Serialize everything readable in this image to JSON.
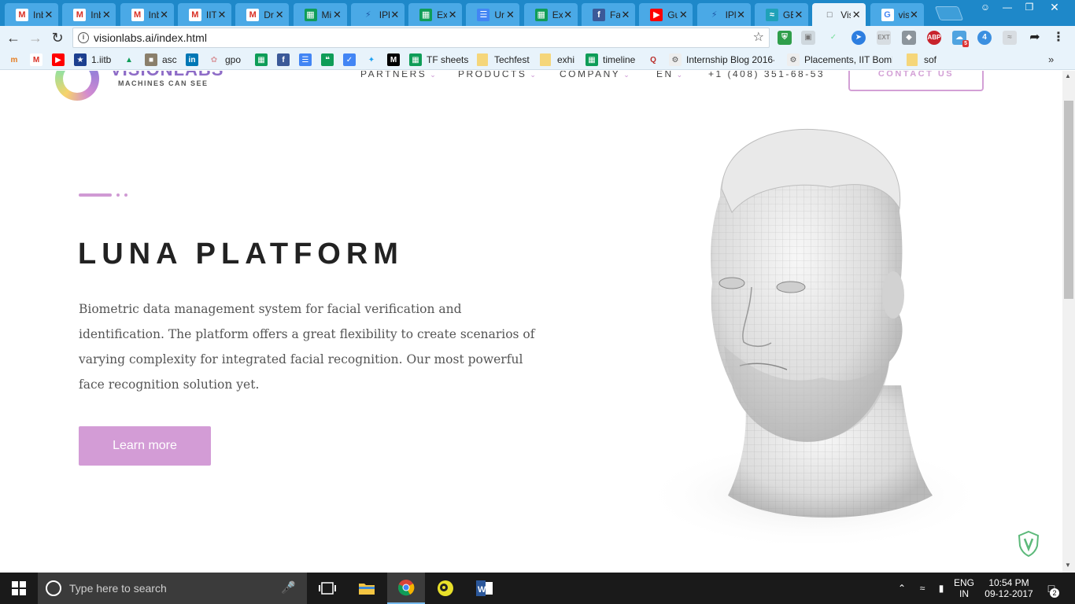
{
  "tabs": [
    {
      "icon": "gmail-icon",
      "title": "Inb"
    },
    {
      "icon": "gmail-icon",
      "title": "Inb"
    },
    {
      "icon": "gmail-icon",
      "title": "Inb"
    },
    {
      "icon": "gmail-icon",
      "title": "IIT"
    },
    {
      "icon": "gmail-icon",
      "title": "Dr"
    },
    {
      "icon": "sheets-icon",
      "title": "Mi"
    },
    {
      "icon": "ipl-icon",
      "title": "IPl"
    },
    {
      "icon": "sheets-icon",
      "title": "Ex"
    },
    {
      "icon": "docs-icon",
      "title": "Ur"
    },
    {
      "icon": "sheets-icon",
      "title": "Ex"
    },
    {
      "icon": "facebook-icon",
      "title": "Fa"
    },
    {
      "icon": "youtube-icon",
      "title": "Gu"
    },
    {
      "icon": "ipl-icon",
      "title": "IPl"
    },
    {
      "icon": "ge-icon",
      "title": "GE"
    },
    {
      "icon": "page-icon",
      "title": "Vis",
      "active": true
    },
    {
      "icon": "google-icon",
      "title": "vis"
    }
  ],
  "address_bar": {
    "url": "visionlabs.ai/index.html"
  },
  "bookmarks": [
    {
      "icon": "mail-m-icon",
      "label": ""
    },
    {
      "icon": "gmail-icon",
      "label": ""
    },
    {
      "icon": "youtube-icon",
      "label": ""
    },
    {
      "icon": "iitb-icon",
      "label": "1.iitb"
    },
    {
      "icon": "drive-icon",
      "label": ""
    },
    {
      "icon": "image-icon",
      "label": "asc"
    },
    {
      "icon": "linkedin-icon",
      "label": ""
    },
    {
      "icon": "brain-icon",
      "label": "gpo"
    },
    {
      "icon": "sheets-icon",
      "label": ""
    },
    {
      "icon": "facebook-icon",
      "label": ""
    },
    {
      "icon": "docs-icon",
      "label": ""
    },
    {
      "icon": "hangouts-icon",
      "label": ""
    },
    {
      "icon": "inbox-icon",
      "label": ""
    },
    {
      "icon": "twitter-icon",
      "label": ""
    },
    {
      "icon": "medium-icon",
      "label": ""
    },
    {
      "icon": "sheets-icon",
      "label": "TF sheets"
    },
    {
      "icon": "folder-icon",
      "label": "Techfest"
    },
    {
      "icon": "folder-icon",
      "label": "exhi"
    },
    {
      "icon": "sheets-icon",
      "label": "timeline"
    },
    {
      "icon": "quora-icon",
      "label": ""
    },
    {
      "icon": "blog-icon",
      "label": "Internship Blog 2016-"
    },
    {
      "icon": "blog-icon",
      "label": "Placements, IIT Bomb"
    },
    {
      "icon": "folder-icon",
      "label": "sof"
    }
  ],
  "site": {
    "logo_brand": "VISIONLABS",
    "logo_tagline": "MACHINES CAN SEE",
    "nav": [
      "PARTNERS",
      "PRODUCTS",
      "COMPANY",
      "EN"
    ],
    "phone": "+1 (408) 351-68-53",
    "contact_label": "CONTACT US"
  },
  "hero": {
    "title": "LUNA PLATFORM",
    "description": "Biometric data management system for facial verification and identification. The platform offers a great flexibility to create scenarios of varying complexity for integrated facial recognition. Our most powerful face recognition solution yet.",
    "cta": "Learn more"
  },
  "taskbar": {
    "search_placeholder": "Type here to search",
    "lang_top": "ENG",
    "lang_bottom": "IN",
    "time": "10:54 PM",
    "date": "09-12-2017",
    "notifications": "2"
  },
  "extensions": {
    "abp_label": "ABP",
    "badge_count": "5",
    "badge_num": "4"
  },
  "colors": {
    "chrome_tabbar": "#1e88c9",
    "accent": "#d39cd6",
    "title_text": "#222222"
  }
}
